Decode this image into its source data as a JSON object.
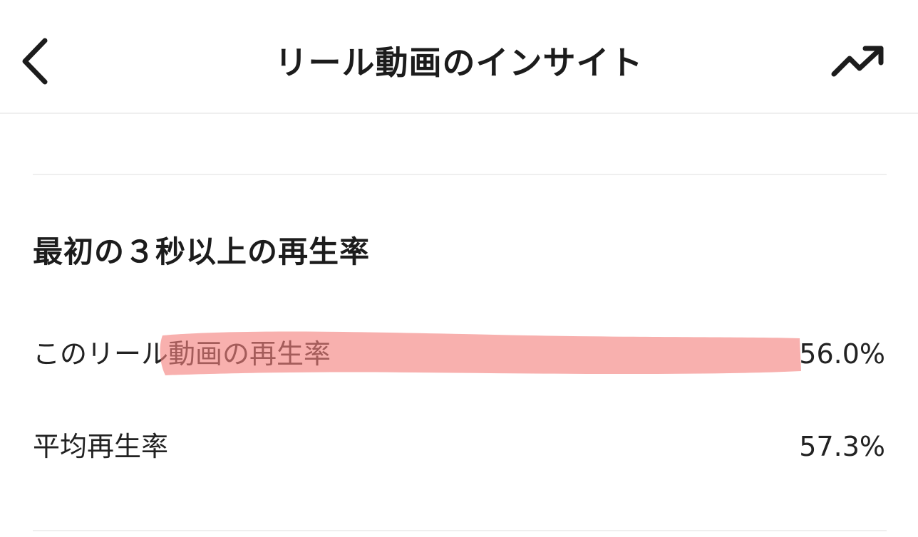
{
  "header": {
    "title": "リール動画のインサイト",
    "back_icon": "chevron-left-icon",
    "trend_icon": "trending-up-icon"
  },
  "section": {
    "title": "最初の３秒以上の再生率"
  },
  "rows": [
    {
      "label": "このリール動画の再生率",
      "value": "56.0%"
    },
    {
      "label": "平均再生率",
      "value": "57.3%"
    }
  ],
  "colors": {
    "highlight": "#f47f7c",
    "text": "#1c1c1c",
    "divider": "#efefef"
  }
}
